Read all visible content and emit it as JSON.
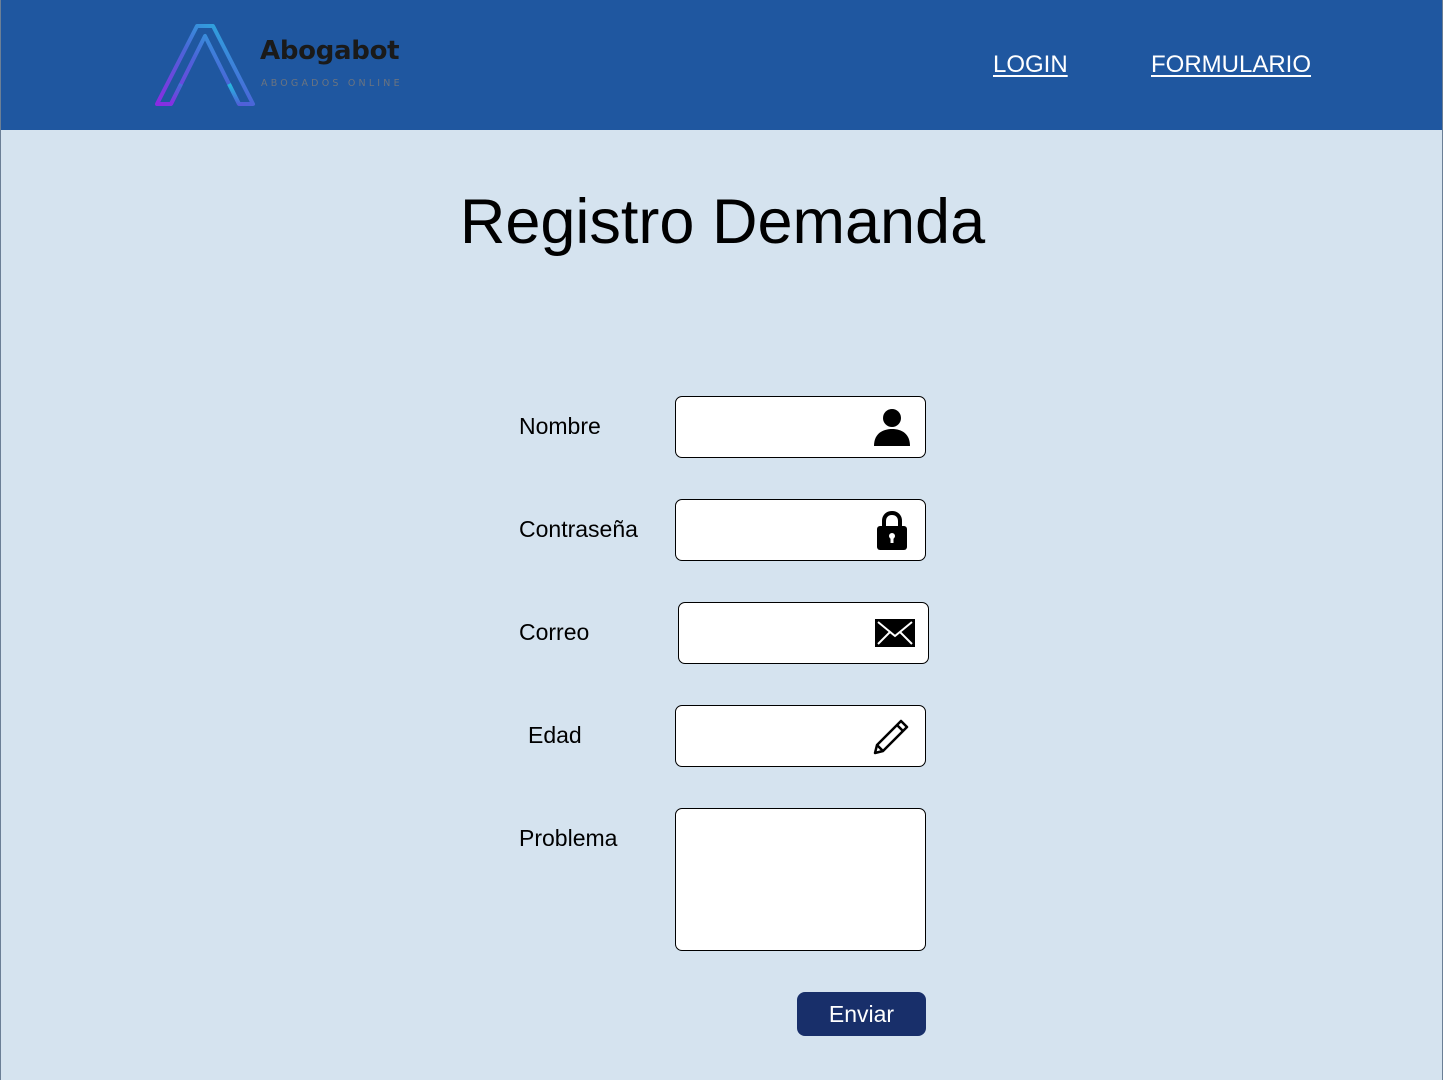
{
  "header": {
    "brand_name": "Abogabot",
    "brand_tagline": "ABOGADOS ONLINE",
    "nav": [
      {
        "label": "LOGIN"
      },
      {
        "label": "FORMULARIO"
      }
    ]
  },
  "main": {
    "title": "Registro Demanda",
    "fields": [
      {
        "label": "Nombre",
        "value": "",
        "icon": "user-icon"
      },
      {
        "label": "Contraseña",
        "value": "",
        "icon": "lock-icon"
      },
      {
        "label": "Correo",
        "value": "",
        "icon": "envelope-icon"
      },
      {
        "label": "Edad",
        "value": "",
        "icon": "pencil-icon"
      },
      {
        "label": "Problema",
        "value": ""
      }
    ],
    "submit_label": "Enviar"
  },
  "colors": {
    "header_bg": "#1f57a0",
    "page_bg": "#d5e3ef",
    "button_bg": "#182f6a"
  }
}
